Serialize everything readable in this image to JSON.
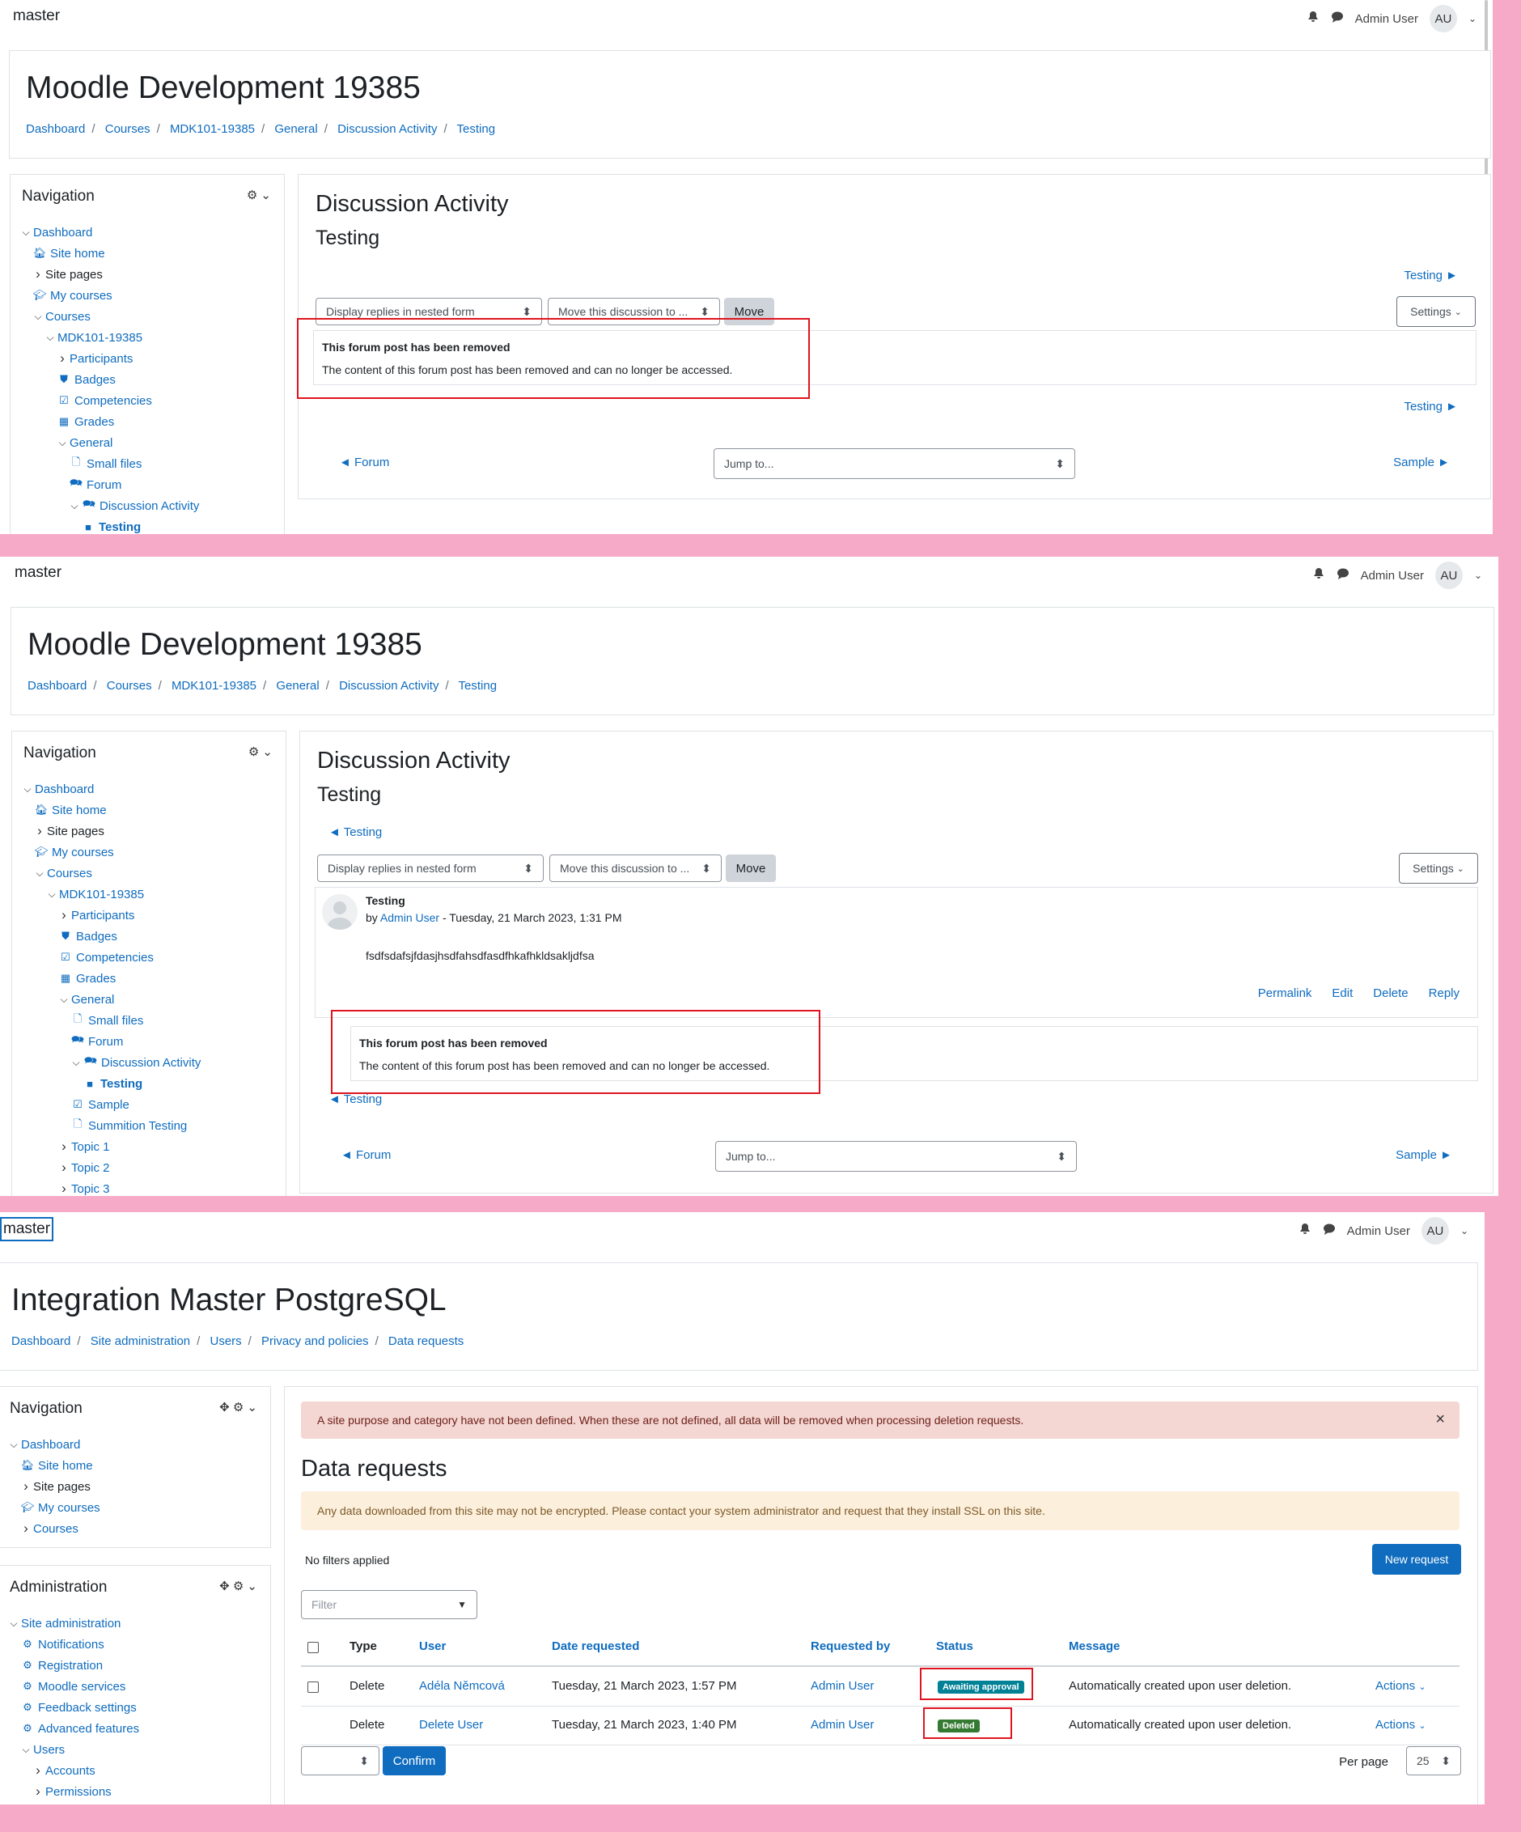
{
  "shared": {
    "brand": "master",
    "user": "Admin User",
    "initials": "AU"
  },
  "panel1": {
    "site_title": "Moodle Development 19385",
    "breadcrumbs": [
      "Dashboard",
      "Courses",
      "MDK101-19385",
      "General",
      "Discussion Activity",
      "Testing"
    ],
    "nav_title": "Navigation",
    "nav": [
      {
        "label": "Dashboard",
        "chev": "down",
        "icon": "",
        "level": 0,
        "style": "link"
      },
      {
        "label": "Site home",
        "chev": "",
        "icon": "home-icon",
        "level": 1,
        "style": "link"
      },
      {
        "label": "Site pages",
        "chev": "right",
        "icon": "",
        "level": 1,
        "style": "dark"
      },
      {
        "label": "My courses",
        "chev": "",
        "icon": "graduation-cap-icon",
        "level": 1,
        "style": "link"
      },
      {
        "label": "Courses",
        "chev": "down",
        "icon": "",
        "level": 1,
        "style": "link"
      },
      {
        "label": "MDK101-19385",
        "chev": "down",
        "icon": "",
        "level": 2,
        "style": "link"
      },
      {
        "label": "Participants",
        "chev": "right",
        "icon": "",
        "level": 3,
        "style": "link"
      },
      {
        "label": "Badges",
        "chev": "",
        "icon": "shield-icon",
        "level": 3,
        "style": "link"
      },
      {
        "label": "Competencies",
        "chev": "",
        "icon": "checkbox-icon",
        "level": 3,
        "style": "link"
      },
      {
        "label": "Grades",
        "chev": "",
        "icon": "table-icon",
        "level": 3,
        "style": "link"
      },
      {
        "label": "General",
        "chev": "down",
        "icon": "",
        "level": 3,
        "style": "link"
      },
      {
        "label": "Small files",
        "chev": "",
        "icon": "file-icon",
        "level": 4,
        "style": "link"
      },
      {
        "label": "Forum",
        "chev": "",
        "icon": "forum-icon",
        "level": 4,
        "style": "link"
      },
      {
        "label": "Discussion Activity",
        "chev": "down",
        "icon": "forum-icon",
        "level": 4,
        "style": "link"
      },
      {
        "label": "Testing",
        "chev": "",
        "icon": "square-icon",
        "level": 5,
        "style": "bold"
      }
    ],
    "activity_title": "Discussion Activity",
    "discussion_title": "Testing",
    "next_link": "Testing ►",
    "display_select": "Display replies in nested form",
    "move_select": "Move this discussion to ...",
    "move_button": "Move",
    "settings_button": "Settings",
    "removed_title": "This forum post has been removed",
    "removed_text": "The content of this forum post has been removed and can no longer be accessed.",
    "prev_activity": "◄ Forum",
    "jump_to": "Jump to...",
    "next_activity": "Sample ►"
  },
  "panel2": {
    "site_title": "Moodle Development 19385",
    "breadcrumbs": [
      "Dashboard",
      "Courses",
      "MDK101-19385",
      "General",
      "Discussion Activity",
      "Testing"
    ],
    "nav_title": "Navigation",
    "nav": [
      {
        "label": "Dashboard",
        "chev": "down",
        "icon": "",
        "level": 0,
        "style": "link"
      },
      {
        "label": "Site home",
        "chev": "",
        "icon": "home-icon",
        "level": 1,
        "style": "link"
      },
      {
        "label": "Site pages",
        "chev": "right",
        "icon": "",
        "level": 1,
        "style": "dark"
      },
      {
        "label": "My courses",
        "chev": "",
        "icon": "graduation-cap-icon",
        "level": 1,
        "style": "link"
      },
      {
        "label": "Courses",
        "chev": "down",
        "icon": "",
        "level": 1,
        "style": "link"
      },
      {
        "label": "MDK101-19385",
        "chev": "down",
        "icon": "",
        "level": 2,
        "style": "link"
      },
      {
        "label": "Participants",
        "chev": "right",
        "icon": "",
        "level": 3,
        "style": "link"
      },
      {
        "label": "Badges",
        "chev": "",
        "icon": "shield-icon",
        "level": 3,
        "style": "link"
      },
      {
        "label": "Competencies",
        "chev": "",
        "icon": "checkbox-icon",
        "level": 3,
        "style": "link"
      },
      {
        "label": "Grades",
        "chev": "",
        "icon": "table-icon",
        "level": 3,
        "style": "link"
      },
      {
        "label": "General",
        "chev": "down",
        "icon": "",
        "level": 3,
        "style": "link"
      },
      {
        "label": "Small files",
        "chev": "",
        "icon": "file-icon",
        "level": 4,
        "style": "link"
      },
      {
        "label": "Forum",
        "chev": "",
        "icon": "forum-icon",
        "level": 4,
        "style": "link"
      },
      {
        "label": "Discussion Activity",
        "chev": "down",
        "icon": "forum-icon",
        "level": 4,
        "style": "link"
      },
      {
        "label": "Testing",
        "chev": "",
        "icon": "square-icon",
        "level": 5,
        "style": "bold"
      },
      {
        "label": "Sample",
        "chev": "",
        "icon": "checkbox-icon",
        "level": 4,
        "style": "link"
      },
      {
        "label": "Summition Testing",
        "chev": "",
        "icon": "file-icon",
        "level": 4,
        "style": "link"
      },
      {
        "label": "Topic 1",
        "chev": "right",
        "icon": "",
        "level": 3,
        "style": "link"
      },
      {
        "label": "Topic 2",
        "chev": "right",
        "icon": "",
        "level": 3,
        "style": "link"
      },
      {
        "label": "Topic 3",
        "chev": "right",
        "icon": "",
        "level": 3,
        "style": "link"
      }
    ],
    "activity_title": "Discussion Activity",
    "discussion_title": "Testing",
    "prev_link": "◄ Testing",
    "display_select": "Display replies in nested form",
    "move_select": "Move this discussion to ...",
    "move_button": "Move",
    "settings_button": "Settings",
    "post_subject": "Testing",
    "post_by": "by",
    "post_author": "Admin User",
    "post_date": " - Tuesday, 21 March 2023, 1:31 PM",
    "post_body": "fsdfsdafsjfdasjhsdfahsdfasdfhkafhkldsakljdfsa",
    "actions": [
      "Permalink",
      "Edit",
      "Delete",
      "Reply"
    ],
    "removed_title": "This forum post has been removed",
    "removed_text": "The content of this forum post has been removed and can no longer be accessed.",
    "prev_link_bottom": "◄ Testing",
    "prev_activity": "◄ Forum",
    "jump_to": "Jump to...",
    "next_activity": "Sample ►"
  },
  "panel3": {
    "site_title": "Integration Master PostgreSQL",
    "breadcrumbs": [
      "Dashboard",
      "Site administration",
      "Users",
      "Privacy and policies",
      "Data requests"
    ],
    "nav_title": "Navigation",
    "nav": [
      {
        "label": "Dashboard",
        "chev": "down",
        "icon": "",
        "level": 0,
        "style": "link"
      },
      {
        "label": "Site home",
        "chev": "",
        "icon": "home-icon",
        "level": 1,
        "style": "link"
      },
      {
        "label": "Site pages",
        "chev": "right",
        "icon": "",
        "level": 1,
        "style": "dark"
      },
      {
        "label": "My courses",
        "chev": "",
        "icon": "graduation-cap-icon",
        "level": 1,
        "style": "link"
      },
      {
        "label": "Courses",
        "chev": "right",
        "icon": "",
        "level": 1,
        "style": "link"
      }
    ],
    "admin_title": "Administration",
    "admin": [
      {
        "label": "Site administration",
        "chev": "down",
        "icon": "",
        "level": 0,
        "style": "link"
      },
      {
        "label": "Notifications",
        "chev": "",
        "icon": "gear-icon",
        "level": 1,
        "style": "link"
      },
      {
        "label": "Registration",
        "chev": "",
        "icon": "gear-icon",
        "level": 1,
        "style": "link"
      },
      {
        "label": "Moodle services",
        "chev": "",
        "icon": "gear-icon",
        "level": 1,
        "style": "link"
      },
      {
        "label": "Feedback settings",
        "chev": "",
        "icon": "gear-icon",
        "level": 1,
        "style": "link"
      },
      {
        "label": "Advanced features",
        "chev": "",
        "icon": "gear-icon",
        "level": 1,
        "style": "link"
      },
      {
        "label": "Users",
        "chev": "down",
        "icon": "",
        "level": 1,
        "style": "link"
      },
      {
        "label": "Accounts",
        "chev": "right",
        "icon": "",
        "level": 2,
        "style": "link"
      },
      {
        "label": "Permissions",
        "chev": "right",
        "icon": "",
        "level": 2,
        "style": "link"
      }
    ],
    "alert_danger": "A site purpose and category have not been defined. When these are not defined, all data will be removed when processing deletion requests.",
    "page_heading": "Data requests",
    "alert_warning": "Any data downloaded from this site may not be encrypted. Please contact your system administrator and request that they install SSL on this site.",
    "filters_text": "No filters applied",
    "new_request": "New request",
    "filter_placeholder": "Filter",
    "columns": [
      "Type",
      "User",
      "Date requested",
      "Requested by",
      "Status",
      "Message"
    ],
    "rows": [
      {
        "type": "Delete",
        "user": "Adéla Němcová",
        "date": "Tuesday, 21 March 2023, 1:57 PM",
        "by": "Admin User",
        "status": "Awaiting approval",
        "message": "Automatically created upon user deletion.",
        "actions": "Actions"
      },
      {
        "type": "Delete",
        "user": "Delete User",
        "date": "Tuesday, 21 March 2023, 1:40 PM",
        "by": "Admin User",
        "status": "Deleted",
        "message": "Automatically created upon user deletion.",
        "actions": "Actions"
      }
    ],
    "status_colors": {
      "Awaiting approval": "#008196",
      "Deleted": "#357a32"
    },
    "confirm": "Confirm",
    "per_page_label": "Per page",
    "per_page": "25"
  }
}
